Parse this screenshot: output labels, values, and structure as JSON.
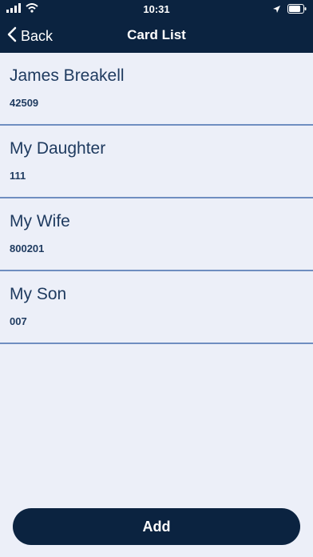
{
  "status_bar": {
    "time": "10:31",
    "icons": [
      "signal-icon",
      "wifi-icon",
      "location-icon",
      "battery-icon"
    ]
  },
  "nav": {
    "back_label": "Back",
    "title": "Card List"
  },
  "cards": [
    {
      "name": "James Breakell",
      "number": "42509"
    },
    {
      "name": "My Daughter",
      "number": "111"
    },
    {
      "name": "My Wife",
      "number": "800201"
    },
    {
      "name": "My Son",
      "number": "007"
    }
  ],
  "add_button": {
    "label": "Add"
  },
  "colors": {
    "header": "#0b2340",
    "background": "#eceff8",
    "text": "#1e3a5f",
    "divider": "#6f8ec0",
    "button": "#0b2340"
  }
}
